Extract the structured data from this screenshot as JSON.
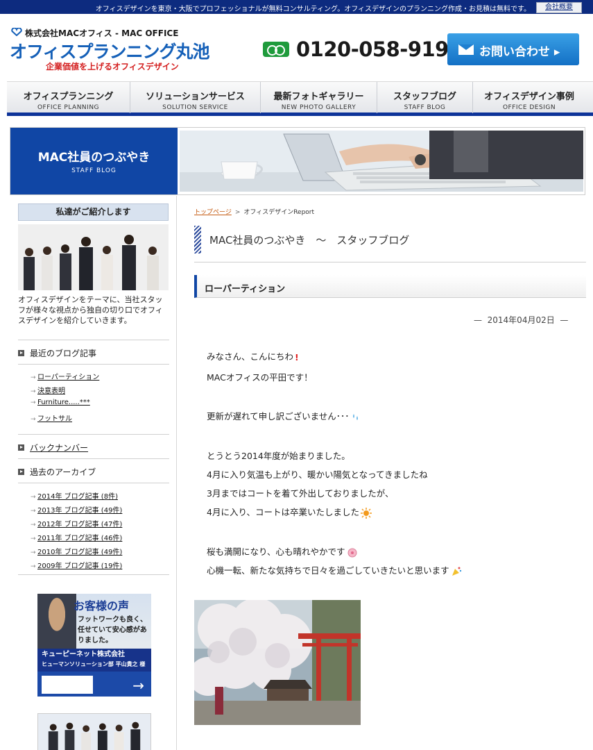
{
  "topbar": {
    "message": "オフィスデザインを東京・大阪でプロフェッショナルが無料コンサルティング。オフィスデザインのプランニング作成・お見積は無料です。",
    "corp_link": "会社概要"
  },
  "header": {
    "company": "株式会社MACオフィス - MAC OFFICE",
    "brand": "オフィスプランニング丸池",
    "tagline": "企業価値を上げるオフィスデザイン",
    "phone": "0120-058-919",
    "contact_label": "お問い合わせ"
  },
  "nav": [
    {
      "jp": "オフィスプランニング",
      "en": "OFFICE PLANNING"
    },
    {
      "jp": "ソリューションサービス",
      "en": "SOLUTION SERVICE"
    },
    {
      "jp": "最新フォトギャラリー",
      "en": "NEW PHOTO GALLERY"
    },
    {
      "jp": "スタッフブログ",
      "en": "STAFF BLOG"
    },
    {
      "jp": "オフィスデザイン事例",
      "en": "OFFICE DESIGN"
    }
  ],
  "banner": {
    "title": "MAC社員のつぶやき",
    "subtitle": "STAFF BLOG"
  },
  "sidebar": {
    "intro_header": "私達がご紹介します",
    "intro_text": "オフィスデザインをテーマに、当社スタッフが様々な視点から独自の切り口でオフィスデザインを紹介していきます。",
    "recent_title": "最近のブログ記事",
    "recent_items": [
      "ローパーティション",
      "決意表明",
      "Furniture.....***",
      "フットサル"
    ],
    "backnumber_title": "バックナンバー",
    "archive_title": "過去のアーカイブ",
    "archive_items": [
      "2014年 ブログ記事 (8件)",
      "2013年 ブログ記事 (49件)",
      "2012年 ブログ記事 (47件)",
      "2011年 ブログ記事 (46件)",
      "2010年 ブログ記事 (49件)",
      "2009年 ブログ記事 (19件)"
    ],
    "ad": {
      "heading": "お客様の声",
      "body": "フットワークも良く、任せていて安心感がありました。",
      "company": "キューピーネット株式会社",
      "person": "ヒューマンソリューション部 平山貴之 様"
    }
  },
  "breadcrumb": {
    "home": "トップページ",
    "current": "オフィスデザインReport"
  },
  "blog_title": "MAC社員のつぶやき　～　スタッフブログ",
  "post": {
    "title": "ローパーティション",
    "date": "2014年04月02日",
    "lines": [
      "みなさん、こんにちわ",
      "MACオフィスの平田です！",
      "更新が遅れて申し訳ございません･･･",
      "とうとう2014年度が始まりました。",
      "4月に入り気温も上がり、暖かい陽気となってきましたね",
      "3月まではコートを着て外出しておりましたが、",
      "4月に入り、コートは卒業いたしました",
      "桜も満開になり、心も晴れやかです",
      "心機一転、新たな気持ちで日々を過ごしていきたいと思います"
    ]
  },
  "colors": {
    "navy": "#0d2b7f",
    "brand_blue": "#1046a5",
    "phone_green": "#1f9b3c",
    "tagline_red": "#d41f1f",
    "breadcrumb_orange": "#c45a10"
  }
}
